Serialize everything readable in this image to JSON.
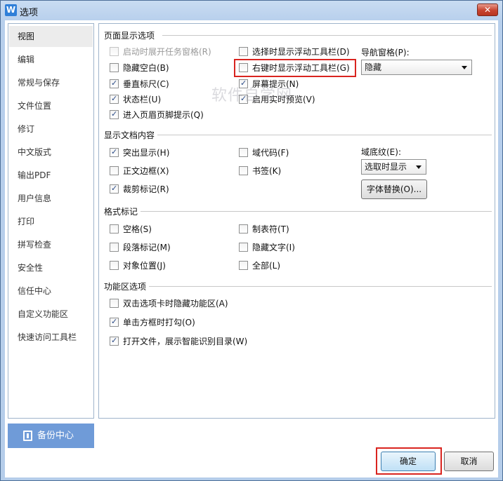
{
  "window": {
    "title": "选项",
    "app_icon_letter": "W",
    "close_glyph": "✕"
  },
  "sidebar": {
    "items": [
      {
        "label": "视图"
      },
      {
        "label": "编辑"
      },
      {
        "label": "常规与保存"
      },
      {
        "label": "文件位置"
      },
      {
        "label": "修订"
      },
      {
        "label": "中文版式"
      },
      {
        "label": "输出PDF"
      },
      {
        "label": "用户信息"
      },
      {
        "label": "打印"
      },
      {
        "label": "拼写检查"
      },
      {
        "label": "安全性"
      },
      {
        "label": "信任中心"
      },
      {
        "label": "自定义功能区"
      },
      {
        "label": "快速访问工具栏"
      }
    ],
    "backup_label": "备份中心"
  },
  "sections": {
    "page_display": {
      "title": "页面显示选项",
      "options": [
        {
          "label": "启动时展开任务窗格(R)",
          "checked": false,
          "disabled": true
        },
        {
          "label": "隐藏空白(B)",
          "checked": false
        },
        {
          "label": "垂直标尺(C)",
          "checked": true
        },
        {
          "label": "状态栏(U)",
          "checked": true
        },
        {
          "label": "进入页眉页脚提示(Q)",
          "checked": true
        },
        {
          "label": "选择时显示浮动工具栏(D)",
          "checked": false
        },
        {
          "label": "右键时显示浮动工具栏(G)",
          "checked": false
        },
        {
          "label": "屏幕提示(N)",
          "checked": true
        },
        {
          "label": "启用实时预览(V)",
          "checked": true
        }
      ],
      "nav_pane_label": "导航窗格(P):",
      "nav_pane_value": "隐藏"
    },
    "doc_content": {
      "title": "显示文档内容",
      "options": [
        {
          "label": "突出显示(H)",
          "checked": true
        },
        {
          "label": "正文边框(X)",
          "checked": false
        },
        {
          "label": "裁剪标记(R)",
          "checked": true
        },
        {
          "label": "域代码(F)",
          "checked": false
        },
        {
          "label": "书签(K)",
          "checked": false
        }
      ],
      "field_shading_label": "域底纹(E):",
      "field_shading_value": "选取时显示",
      "font_substitution_button": "字体替换(O)..."
    },
    "format_marks": {
      "title": "格式标记",
      "options": [
        {
          "label": "空格(S)",
          "checked": false
        },
        {
          "label": "段落标记(M)",
          "checked": false
        },
        {
          "label": "对象位置(J)",
          "checked": false
        },
        {
          "label": "制表符(T)",
          "checked": false
        },
        {
          "label": "隐藏文字(I)",
          "checked": false
        },
        {
          "label": "全部(L)",
          "checked": false
        }
      ]
    },
    "ribbon": {
      "title": "功能区选项",
      "options": [
        {
          "label": "双击选项卡时隐藏功能区(A)",
          "checked": false
        },
        {
          "label": "单击方框时打勾(O)",
          "checked": true
        },
        {
          "label": "打开文件，展示智能识别目录(W)",
          "checked": true
        }
      ]
    }
  },
  "footer": {
    "ok_label": "确定",
    "cancel_label": "取消"
  },
  "watermark": "软件自学网",
  "colors": {
    "highlight": "#d9241f",
    "backup_bg": "#6f9bd8",
    "title_bar": "#b7cfec"
  }
}
